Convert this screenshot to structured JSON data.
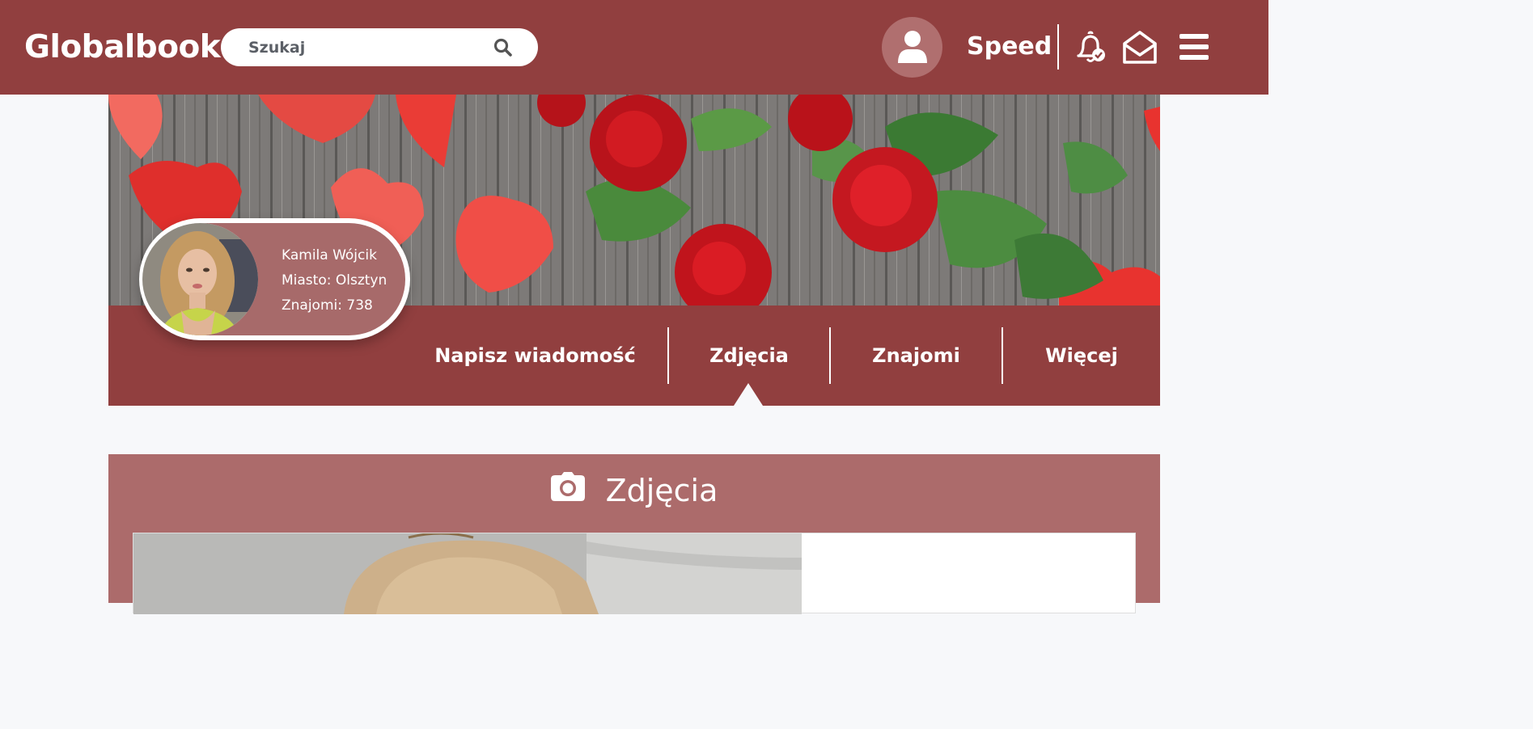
{
  "app": {
    "logo": "Globalbook",
    "search_placeholder": "Szukaj",
    "username": "Speed",
    "icons": {
      "search": "search-icon",
      "avatar": "user-icon",
      "notifications": "bell-check-icon",
      "messages": "envelope-open-icon",
      "menu": "hamburger-menu-icon"
    }
  },
  "profile": {
    "name": "Kamila Wójcik",
    "city": "Miasto: Olsztyn",
    "friends": "Znajomi: 738"
  },
  "tabs": [
    {
      "label": "Napisz wiadomość"
    },
    {
      "label": "Zdjęcia",
      "active": true
    },
    {
      "label": "Znajomi"
    },
    {
      "label": "Więcej"
    }
  ],
  "photos_section": {
    "title": "Zdjęcia",
    "icon": "camera-icon"
  },
  "colors": {
    "primary": "#913f3f",
    "panel": "#ac6b6b",
    "background": "#f7f8fa"
  }
}
